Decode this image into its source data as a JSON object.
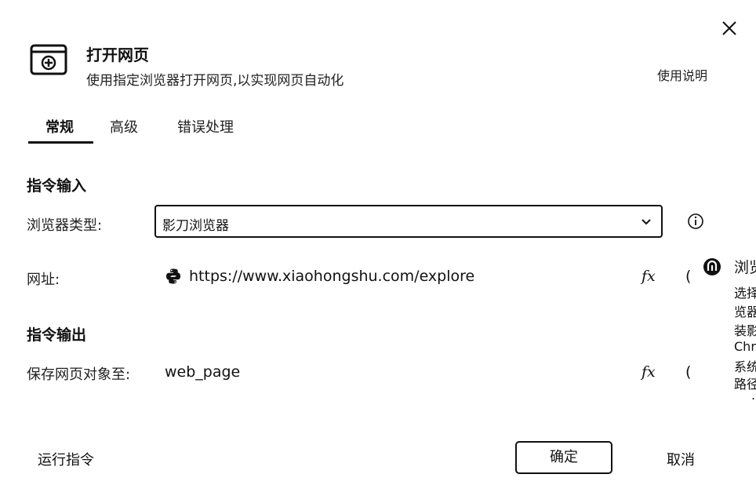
{
  "header": {
    "title": "打开网页",
    "subtitle": "使用指定浏览器打开网页,以实现网页自动化",
    "help_link": "使用说明",
    "icon": "browser-open-icon",
    "close_icon": "close-icon"
  },
  "tabs": [
    {
      "label": "常规",
      "active": true
    },
    {
      "label": "高级",
      "active": false
    },
    {
      "label": "错误处理",
      "active": false
    }
  ],
  "input_section": {
    "title": "指令输入",
    "browser_type": {
      "label": "浏览器类型:",
      "value": "影刀浏览器",
      "info_icon": "info-icon"
    },
    "url": {
      "label": "网址:",
      "value": "https://www.xiaohongshu.com/explore",
      "type_icon": "python-icon",
      "fx": "fx"
    }
  },
  "output_section": {
    "title": "指令输出",
    "save_page": {
      "label": "保存网页对象至:",
      "value": "web_page",
      "fx": "fx"
    }
  },
  "side_panel": {
    "icon": "yingdao-logo-icon",
    "title": "浏览",
    "lines": [
      "选择",
      "览器",
      "装影",
      "Chr",
      "系统",
      "路径"
    ],
    "trailing_mark": "."
  },
  "footer": {
    "run_label": "运行指令",
    "ok_label": "确定",
    "cancel_label": "取消"
  }
}
